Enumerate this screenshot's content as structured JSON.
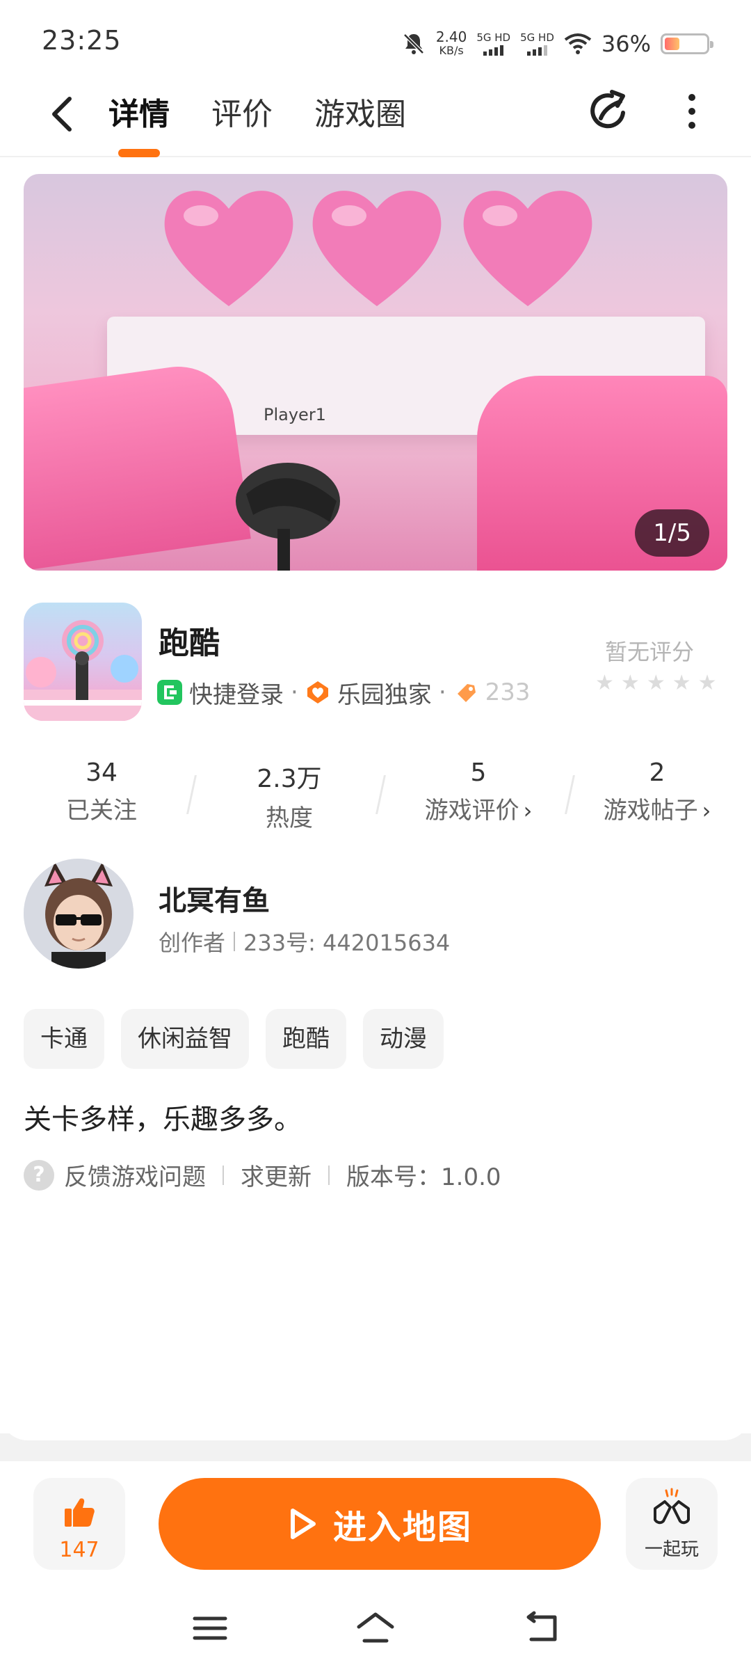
{
  "status_bar": {
    "time": "23:25",
    "net_speed_value": "2.40",
    "net_speed_unit": "KB/s",
    "sim1": "5G HD",
    "sim2": "5G HD",
    "battery_percent": "36%",
    "battery_level": 0.36
  },
  "header": {
    "tabs": [
      "详情",
      "评价",
      "游戏圈"
    ],
    "active_tab": 0,
    "accent_color": "#ff7210"
  },
  "banner": {
    "player_label": "Player1",
    "counter": "1/5"
  },
  "app": {
    "name": "跑酷",
    "badge_login": "快捷登录",
    "badge_exclusive": "乐园独家",
    "badge_more": "233",
    "rating_text": "暂无评分",
    "stars_filled": 0,
    "stars_total": 5
  },
  "stats": [
    {
      "value": "34",
      "label": "已关注",
      "chevron": ""
    },
    {
      "value": "2.3万",
      "label": "热度",
      "chevron": ""
    },
    {
      "value": "5",
      "label": "游戏评价",
      "chevron": "›"
    },
    {
      "value": "2",
      "label": "游戏帖子",
      "chevron": "›"
    }
  ],
  "creator": {
    "name": "北冥有鱼",
    "role": "创作者",
    "id_text": "233号: 442015634"
  },
  "tags": [
    "卡通",
    "休闲益智",
    "跑酷",
    "动漫"
  ],
  "description": "关卡多样，乐趣多多。",
  "feedback": {
    "report": "反馈游戏问题",
    "request_update": "求更新",
    "version": "版本号：1.0.0"
  },
  "actions": {
    "like_count": "147",
    "enter": "进入地图",
    "together": "一起玩"
  },
  "icons": {
    "back": "back-arrow-icon",
    "share": "share-icon",
    "more": "more-vertical-icon",
    "like": "thumbs-up-icon",
    "play": "play-icon",
    "together": "clapping-hands-icon",
    "help": "question-icon"
  }
}
